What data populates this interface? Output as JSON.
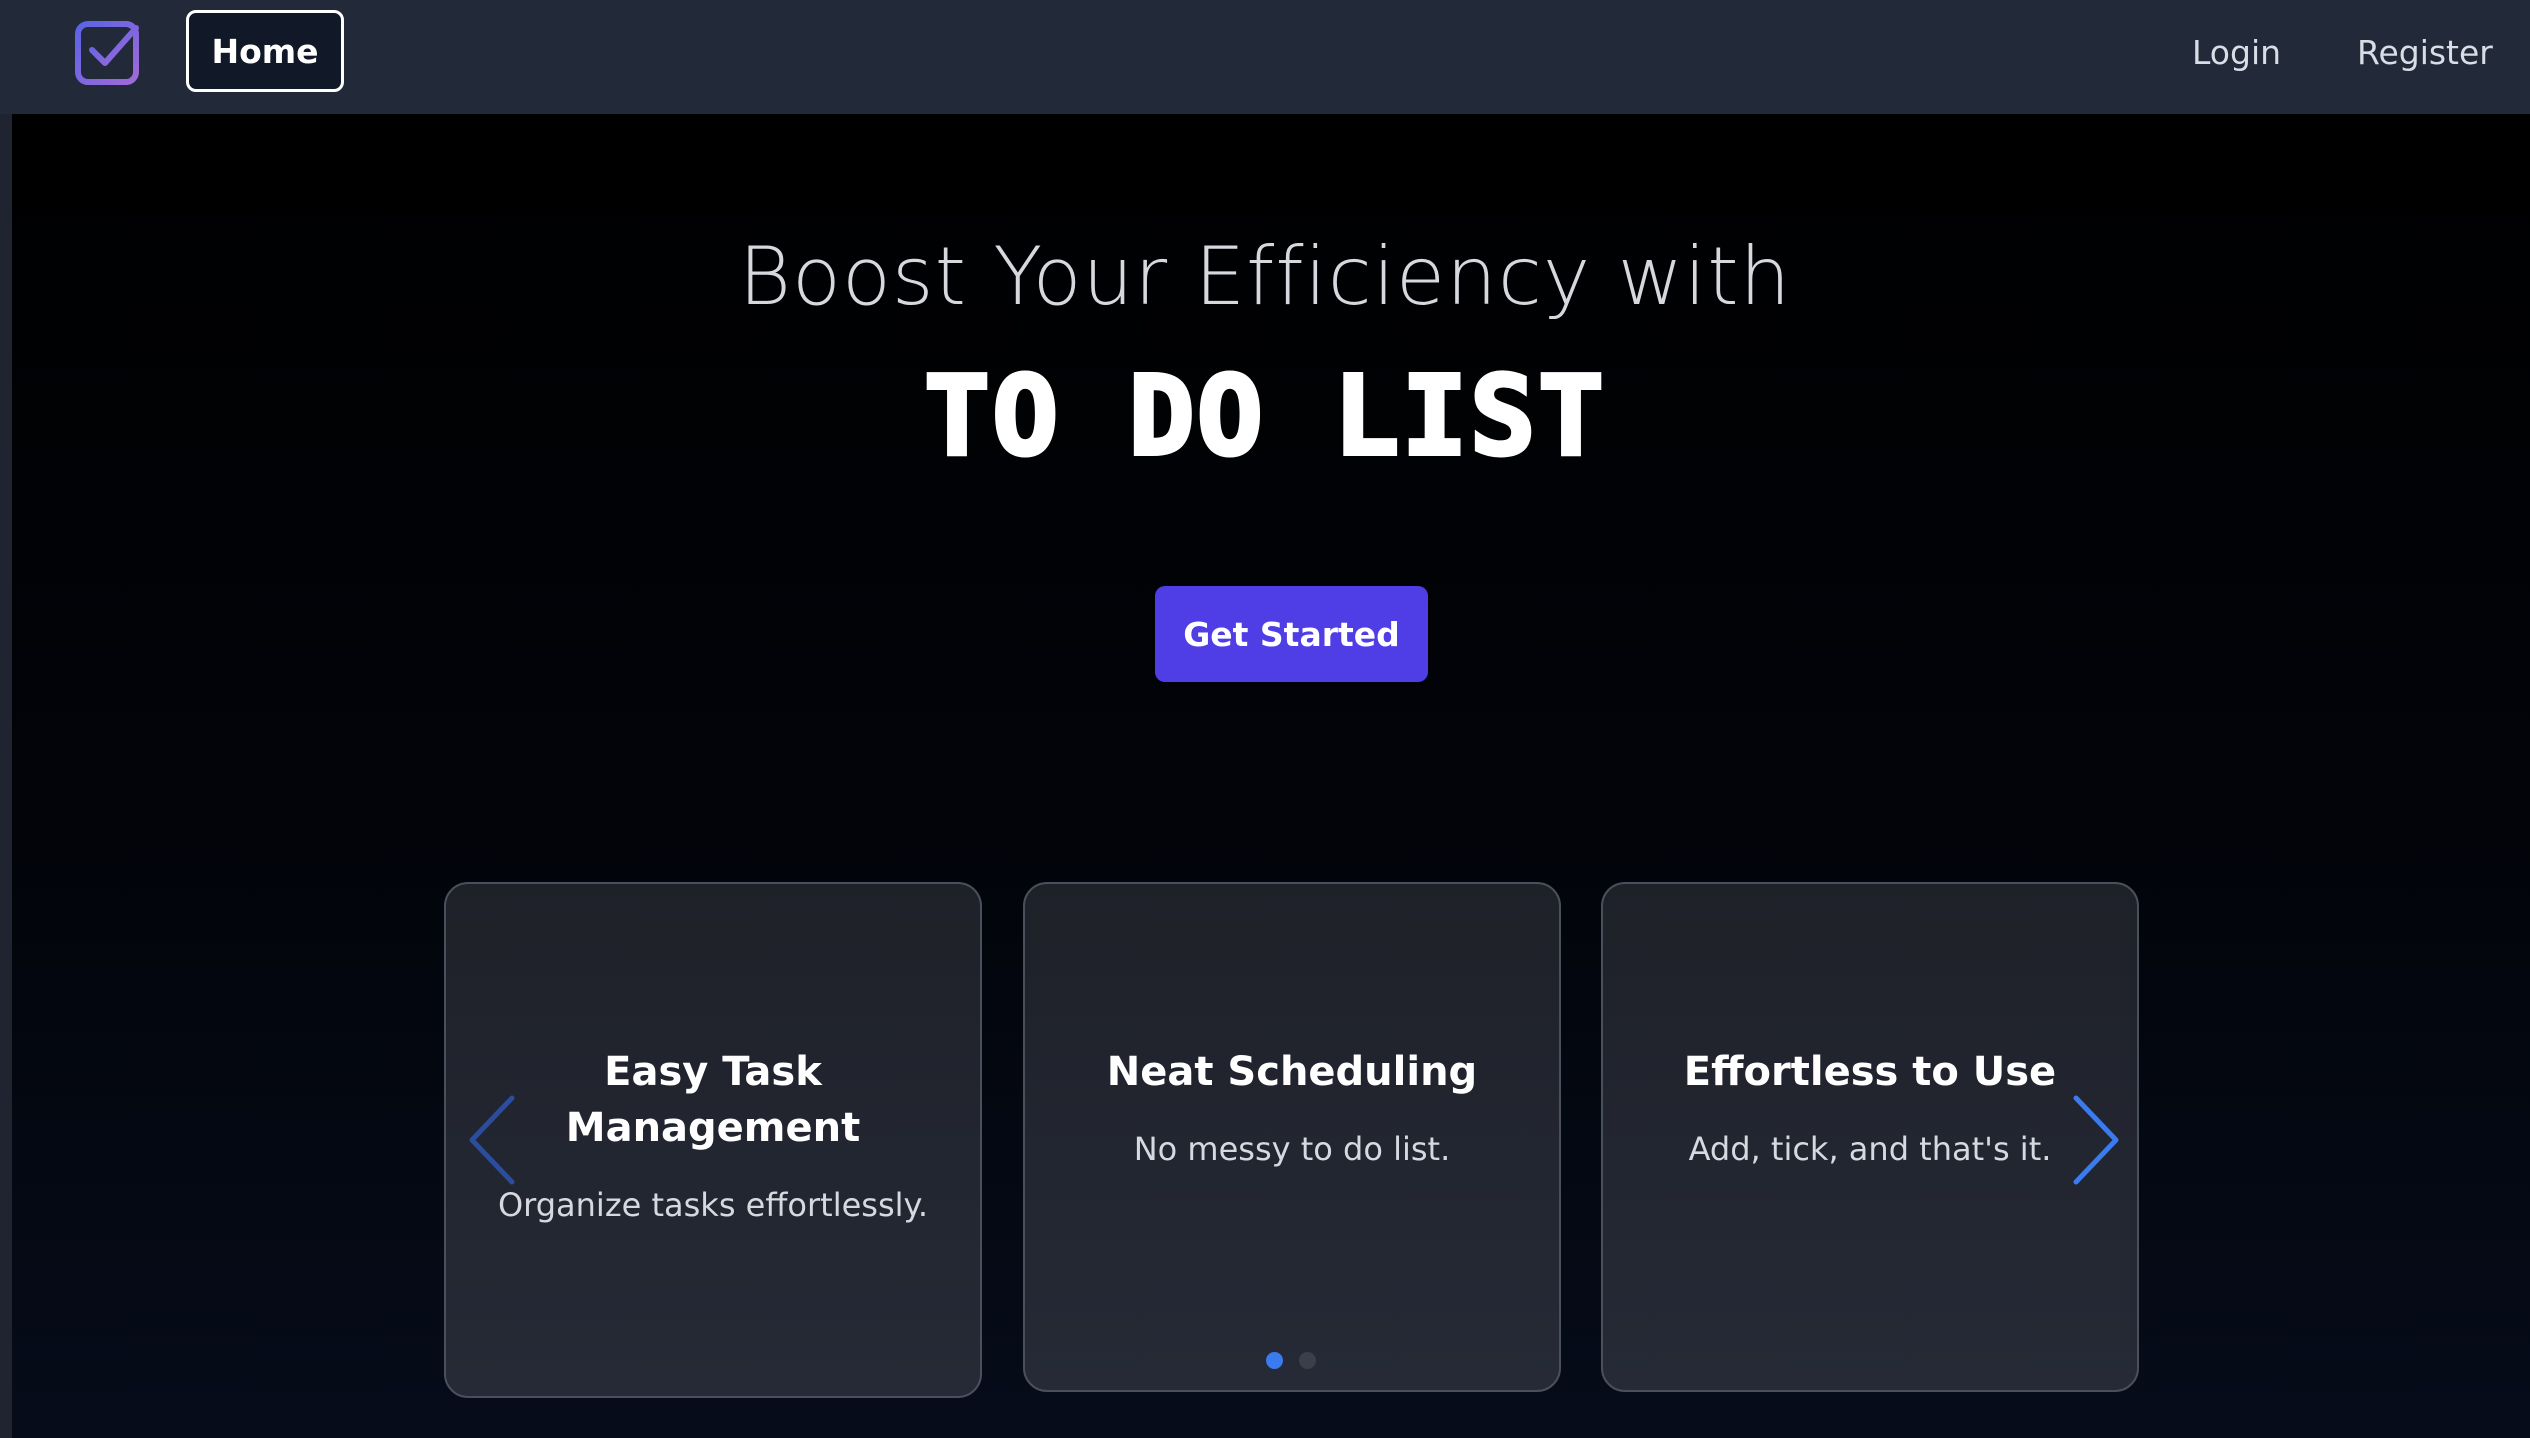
{
  "nav": {
    "logo_icon": "checkbox-logo-icon",
    "home_label": "Home",
    "login_label": "Login",
    "register_label": "Register"
  },
  "hero": {
    "subtitle": "Boost Your Efficiency with",
    "title": "TO DO LIST",
    "cta_label": "Get Started"
  },
  "carousel": {
    "prev_icon": "chevron-left-icon",
    "next_icon": "chevron-right-icon",
    "cards": [
      {
        "title": "Easy Task Management",
        "desc": "Organize tasks effortlessly."
      },
      {
        "title": "Neat Scheduling",
        "desc": "No messy to do list."
      },
      {
        "title": "Effortless to Use",
        "desc": "Add, tick, and that's it."
      }
    ],
    "page_count": 2,
    "active_page": 1
  },
  "colors": {
    "nav_bg": "#222a39",
    "cta_bg": "#4f3ee6",
    "accent_blue": "#3a7bf0"
  }
}
